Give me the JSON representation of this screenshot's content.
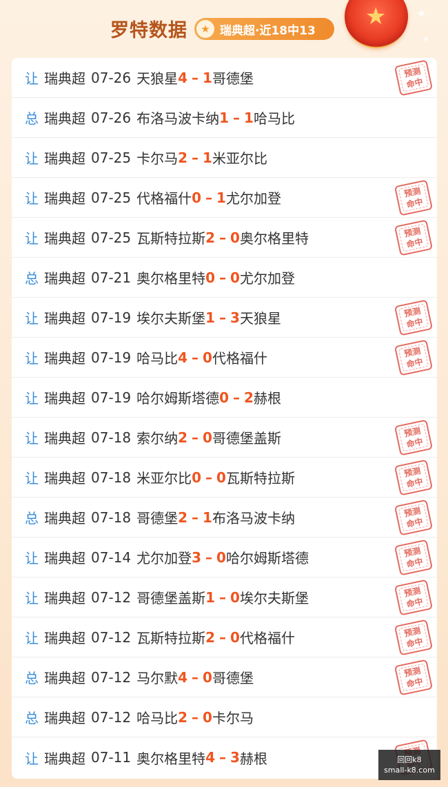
{
  "header": {
    "title": "罗特数据",
    "badge_text": "瑞典超·近18中13"
  },
  "stamp_text": {
    "line1": "预测",
    "line2": "命中"
  },
  "matches": [
    {
      "type": "让",
      "league": "瑞典超",
      "date": "07-26",
      "home": "天狼星",
      "home_score": "4",
      "away_score": "1",
      "away": "哥德堡",
      "hit": true
    },
    {
      "type": "总",
      "league": "瑞典超",
      "date": "07-26",
      "home": "布洛马波卡纳",
      "home_score": "1",
      "away_score": "1",
      "away": "哈马比",
      "hit": false
    },
    {
      "type": "让",
      "league": "瑞典超",
      "date": "07-25",
      "home": "卡尔马",
      "home_score": "2",
      "away_score": "1",
      "away": "米亚尔比",
      "hit": false
    },
    {
      "type": "让",
      "league": "瑞典超",
      "date": "07-25",
      "home": "代格福什",
      "home_score": "0",
      "away_score": "1",
      "away": "尤尔加登",
      "hit": true
    },
    {
      "type": "让",
      "league": "瑞典超",
      "date": "07-25",
      "home": "瓦斯特拉斯",
      "home_score": "2",
      "away_score": "0",
      "away": "奥尔格里特",
      "hit": true
    },
    {
      "type": "总",
      "league": "瑞典超",
      "date": "07-21",
      "home": "奥尔格里特",
      "home_score": "0",
      "away_score": "0",
      "away": "尤尔加登",
      "hit": false
    },
    {
      "type": "让",
      "league": "瑞典超",
      "date": "07-19",
      "home": "埃尔夫斯堡",
      "home_score": "1",
      "away_score": "3",
      "away": "天狼星",
      "hit": true
    },
    {
      "type": "让",
      "league": "瑞典超",
      "date": "07-19",
      "home": "哈马比",
      "home_score": "4",
      "away_score": "0",
      "away": "代格福什",
      "hit": true
    },
    {
      "type": "让",
      "league": "瑞典超",
      "date": "07-19",
      "home": "哈尔姆斯塔德",
      "home_score": "0",
      "away_score": "2",
      "away": "赫根",
      "hit": false
    },
    {
      "type": "让",
      "league": "瑞典超",
      "date": "07-18",
      "home": "索尔纳",
      "home_score": "2",
      "away_score": "0",
      "away": "哥德堡盖斯",
      "hit": true
    },
    {
      "type": "让",
      "league": "瑞典超",
      "date": "07-18",
      "home": "米亚尔比",
      "home_score": "0",
      "away_score": "0",
      "away": "瓦斯特拉斯",
      "hit": true
    },
    {
      "type": "总",
      "league": "瑞典超",
      "date": "07-18",
      "home": "哥德堡",
      "home_score": "2",
      "away_score": "1",
      "away": "布洛马波卡纳",
      "hit": true
    },
    {
      "type": "让",
      "league": "瑞典超",
      "date": "07-14",
      "home": "尤尔加登",
      "home_score": "3",
      "away_score": "0",
      "away": "哈尔姆斯塔德",
      "hit": true
    },
    {
      "type": "让",
      "league": "瑞典超",
      "date": "07-12",
      "home": "哥德堡盖斯",
      "home_score": "1",
      "away_score": "0",
      "away": "埃尔夫斯堡",
      "hit": true
    },
    {
      "type": "让",
      "league": "瑞典超",
      "date": "07-12",
      "home": "瓦斯特拉斯",
      "home_score": "2",
      "away_score": "0",
      "away": "代格福什",
      "hit": true
    },
    {
      "type": "总",
      "league": "瑞典超",
      "date": "07-12",
      "home": "马尔默",
      "home_score": "4",
      "away_score": "0",
      "away": "哥德堡",
      "hit": true
    },
    {
      "type": "总",
      "league": "瑞典超",
      "date": "07-12",
      "home": "哈马比",
      "home_score": "2",
      "away_score": "0",
      "away": "卡尔马",
      "hit": false
    },
    {
      "type": "让",
      "league": "瑞典超",
      "date": "07-11",
      "home": "奥尔格里特",
      "home_score": "4",
      "away_score": "3",
      "away": "赫根",
      "hit": true
    }
  ],
  "watermark": {
    "line1": "回回k8",
    "line2": "small-k8.com"
  }
}
